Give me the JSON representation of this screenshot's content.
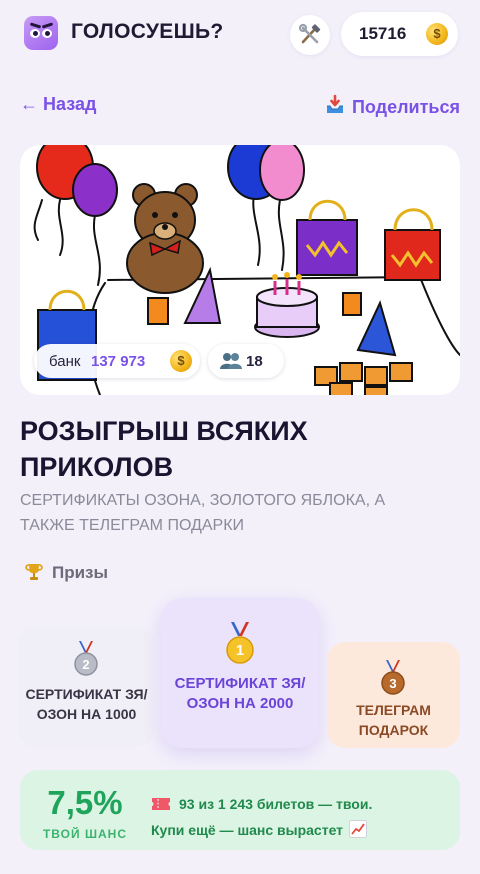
{
  "header": {
    "app_title": "ГОЛОСУЕШЬ?",
    "logo_icon": "owl-logo-icon",
    "tools_icon": "hammer-wrench-icon",
    "balance": "15716",
    "balance_icon": "coin-icon",
    "coin_glyph": "$"
  },
  "nav": {
    "back_label": "← Назад",
    "share_label": "Поделиться",
    "share_icon": "inbox-tray-icon"
  },
  "banner": {
    "illustration": "party-drawing",
    "bank_label": "банк",
    "bank_value": "137 973",
    "participants": "18",
    "participants_icon": "people-icon"
  },
  "raffle": {
    "title": "РОЗЫГРЫШ ВСЯКИХ ПРИКОЛОВ",
    "description": "СЕРТИФИКАТЫ ОЗОНА, ЗОЛОТОГО ЯБЛОКА, А ТАКЖЕ ТЕЛЕГРАМ ПОДАРКИ"
  },
  "prizes": {
    "heading": "Призы",
    "heading_icon": "trophy-icon",
    "items": [
      {
        "place": "2",
        "name": "СЕРТИФИКАТ ЗЯ/ОЗОН НА 1000",
        "medal": "silver-medal-icon"
      },
      {
        "place": "1",
        "name": "СЕРТИФИКАТ ЗЯ/ОЗОН НА 2000",
        "medal": "gold-medal-icon"
      },
      {
        "place": "3",
        "name": "ТЕЛЕГРАМ ПОДАРОК",
        "medal": "bronze-medal-icon"
      }
    ]
  },
  "chance": {
    "percent": "7,5%",
    "label": "ТВОЙ ШАНС",
    "tickets_text": "93 из 1 243 билетов — твои.",
    "cta_text": "Купи ещё — шанс вырастет",
    "ticket_icon": "ticket-icon",
    "trend_icon": "chart-increasing-icon"
  },
  "colors": {
    "accent": "#7b52e6",
    "background": "#f3f0fa",
    "success": "#20a45b",
    "success_bg": "#dcf4e4"
  }
}
